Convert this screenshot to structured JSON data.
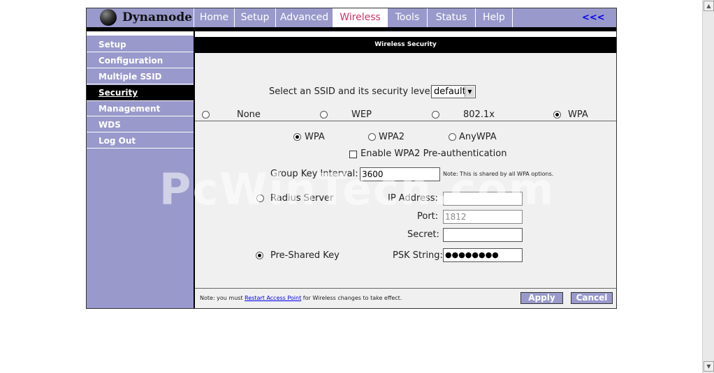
{
  "brand": {
    "name": "Dynamode"
  },
  "nav": {
    "tabs": [
      "Home",
      "Setup",
      "Advanced",
      "Wireless",
      "Tools",
      "Status",
      "Help"
    ],
    "active": "Wireless",
    "collapse_label": "<<<"
  },
  "sidebar": {
    "items": [
      "Setup",
      "Configuration",
      "Multiple SSID",
      "Security",
      "Management",
      "WDS",
      "Log Out"
    ],
    "active": "Security"
  },
  "page": {
    "title": "Wireless Security",
    "ssid_label": "Select an SSID and its security level:",
    "ssid_value": "default",
    "security_modes": [
      "None",
      "WEP",
      "802.1x",
      "WPA"
    ],
    "security_selected": "WPA",
    "wpa_modes": [
      "WPA",
      "WPA2",
      "AnyWPA"
    ],
    "wpa_selected": "WPA",
    "preauth_label": "Enable WPA2 Pre-authentication",
    "preauth_checked": false,
    "group_key_label": "Group Key Interval:",
    "group_key_value": "3600",
    "group_key_note": "Note: This is shared by all WPA options.",
    "radius_label": "Radius Server",
    "ip_label": "IP Address:",
    "ip_value": "",
    "port_label": "Port:",
    "port_value": "1812",
    "secret_label": "Secret:",
    "secret_value": "",
    "psk_label": "Pre-Shared Key",
    "psk_selected": true,
    "psk_string_label": "PSK String:",
    "psk_string_value": "●●●●●●●●",
    "footer_note_prefix": "Note: you must",
    "footer_note_link": "Restart Access Point",
    "footer_note_suffix": "for Wireless changes to take effect.",
    "apply_label": "Apply",
    "cancel_label": "Cancel"
  },
  "watermark": "PcWinTech.com",
  "colors": {
    "accent": "#9999cc",
    "active_tab_text": "#cc3366",
    "link": "#0000ee"
  }
}
